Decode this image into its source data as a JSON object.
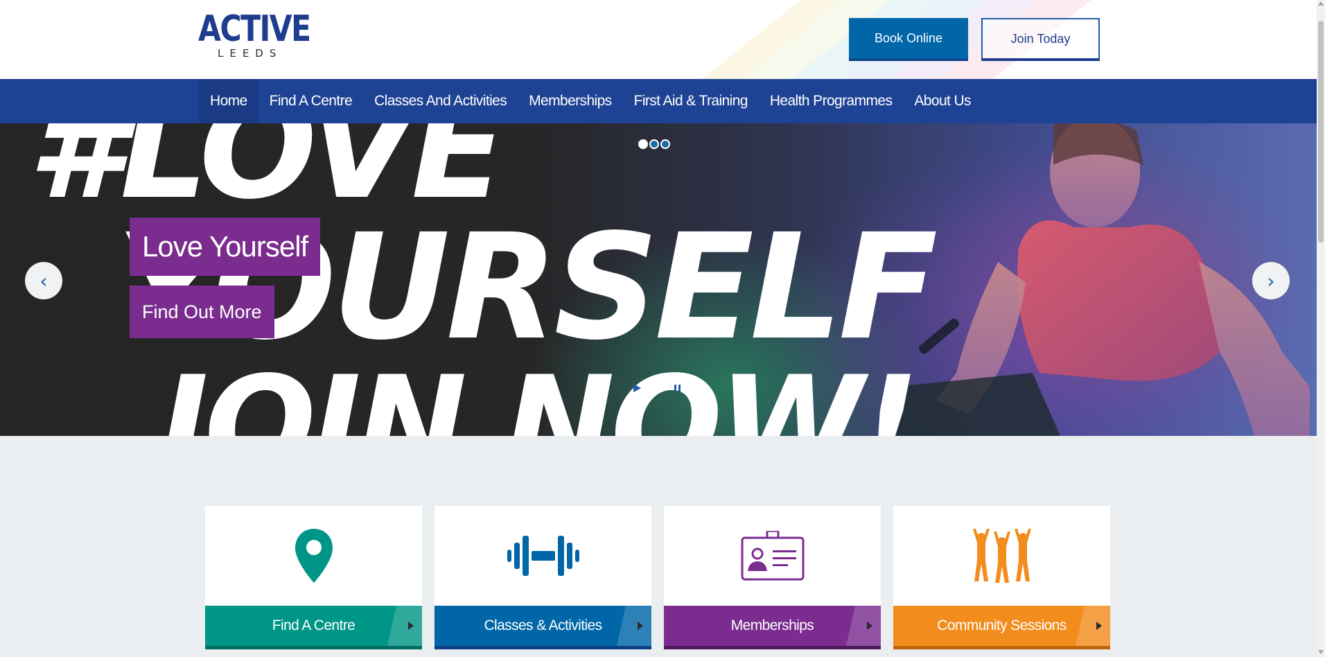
{
  "header": {
    "logo_main": "ACTIVE",
    "logo_sub": "LEEDS",
    "book_online_label": "Book Online",
    "join_today_label": "Join Today"
  },
  "nav": {
    "items": [
      {
        "label": "Home",
        "active": true
      },
      {
        "label": "Find A Centre",
        "active": false
      },
      {
        "label": "Classes And Activities",
        "active": false
      },
      {
        "label": "Memberships",
        "active": false
      },
      {
        "label": "First Aid & Training",
        "active": false
      },
      {
        "label": "Health Programmes",
        "active": false
      },
      {
        "label": "About Us",
        "active": false
      }
    ]
  },
  "hero": {
    "bg_text_line1": "#LOVE",
    "bg_text_line2": "YOURSELF",
    "bg_text_line3": "JOIN NOW!",
    "slide_title": "Love Yourself",
    "cta_label": "Find Out More",
    "prev_arrow": "‹",
    "next_arrow": "›",
    "slides_total": 3,
    "slide_active": 1
  },
  "cards": [
    {
      "label": "Find A Centre",
      "icon": "location-pin-icon",
      "color": "#009687"
    },
    {
      "label": "Classes & Activities",
      "icon": "dumbbell-icon",
      "color": "#0066a8"
    },
    {
      "label": "Memberships",
      "icon": "membership-card-icon",
      "color": "#7b2c8f"
    },
    {
      "label": "Community Sessions",
      "icon": "people-cheering-icon",
      "color": "#f28c1d"
    }
  ],
  "colors": {
    "brand_navy": "#1f3d8e",
    "nav_bg": "#1f4394",
    "cta_purple": "#7b2c8f",
    "book_blue": "#0066a8"
  }
}
